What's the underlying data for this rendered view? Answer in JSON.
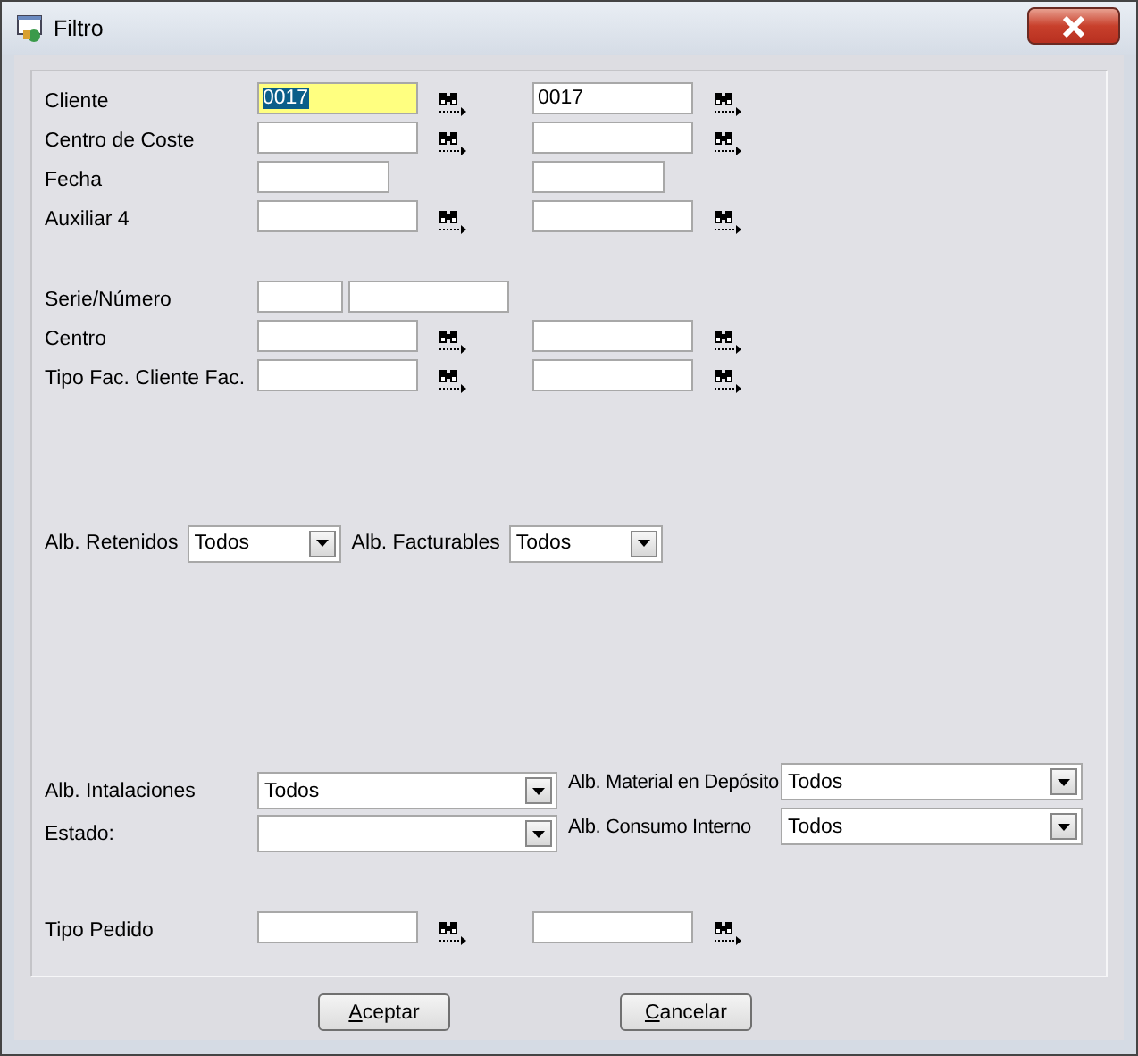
{
  "window": {
    "title": "Filtro"
  },
  "top_rows": [
    {
      "kind": "range",
      "label": "Cliente",
      "from": {
        "value": "0017",
        "focused": true,
        "text_selected": true,
        "lookup": true
      },
      "to": {
        "value": "0017",
        "focused": false,
        "lookup": true
      }
    },
    {
      "kind": "range",
      "label": "Centro de Coste",
      "from": {
        "focused": false,
        "lookup": true
      },
      "to": {
        "focused": false,
        "lookup": true
      }
    },
    {
      "kind": "date",
      "label": "Fecha",
      "from": {
        "focused": false,
        "lookup": false
      },
      "to": {
        "focused": false,
        "lookup": false
      }
    },
    {
      "kind": "range",
      "label": "Auxiliar 4",
      "from": {
        "focused": false,
        "lookup": true
      },
      "to": {
        "focused": false,
        "lookup": true
      }
    }
  ],
  "middle_rows": [
    {
      "kind": "serie",
      "label": "Serie/Número"
    },
    {
      "kind": "range",
      "label": "Centro",
      "from": {
        "focused": false,
        "lookup": true
      },
      "to": {
        "focused": false,
        "lookup": true
      }
    },
    {
      "kind": "range",
      "label": "Tipo Fac. Cliente Fac.",
      "from": {
        "focused": false,
        "lookup": true
      },
      "to": {
        "focused": false,
        "lookup": true
      }
    }
  ],
  "small_combos": [
    {
      "label": "Alb. Retenidos",
      "value": "Todos"
    },
    {
      "label": "Alb. Facturables",
      "value": "Todos"
    }
  ],
  "left_combos": [
    {
      "label": "Alb. Intalaciones",
      "value": "Todos"
    },
    {
      "label": "Estado:"
    }
  ],
  "right_combos": [
    {
      "label": "Alb. Material en Depósito",
      "value": "Todos"
    },
    {
      "label": "Alb. Consumo Interno",
      "value": "Todos"
    }
  ],
  "bottom_rows": [
    {
      "kind": "range",
      "label": "Tipo Pedido",
      "from": {
        "focused": false,
        "lookup": true
      },
      "to": {
        "focused": false,
        "lookup": true
      }
    }
  ],
  "buttons": [
    {
      "label": "Aceptar",
      "underline_first": true
    },
    {
      "label": "Cancelar",
      "underline_first": true
    }
  ]
}
